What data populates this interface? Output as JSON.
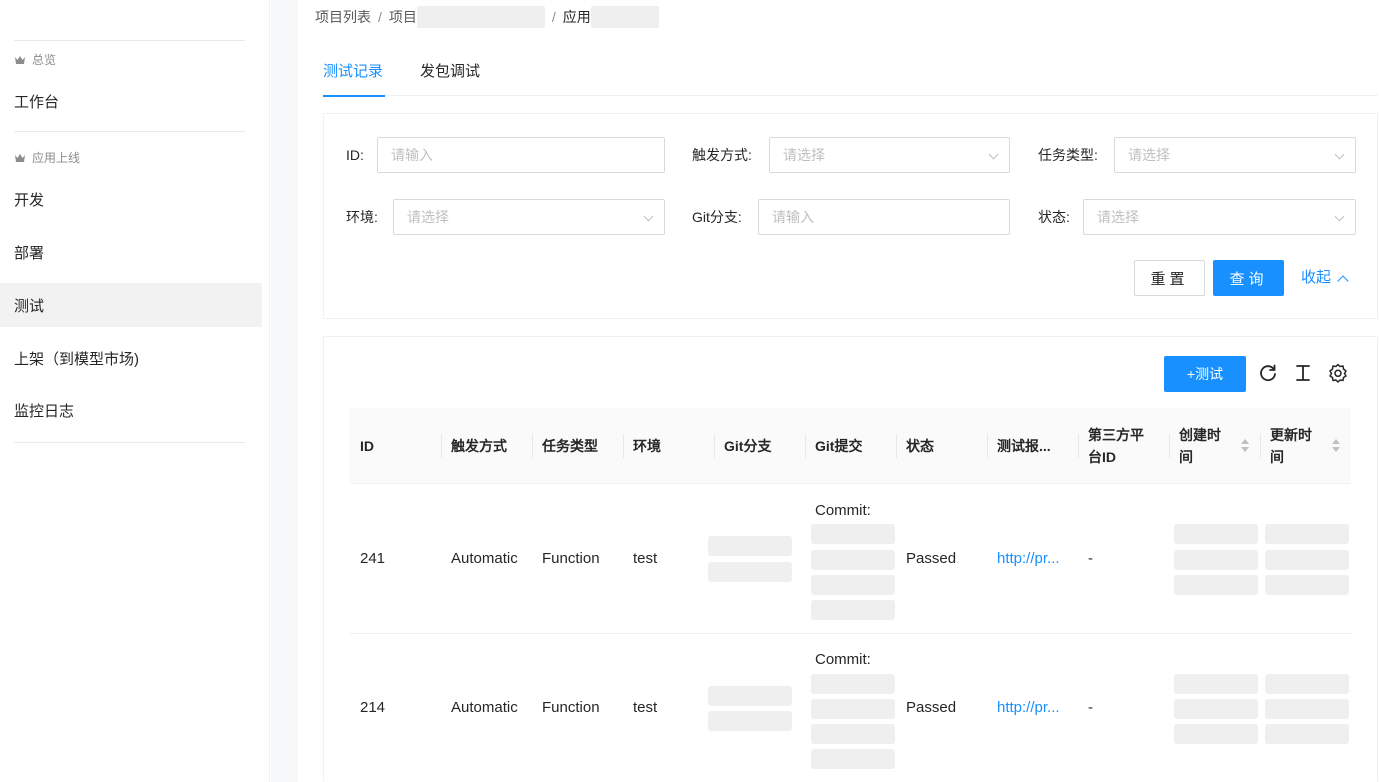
{
  "sidebar": {
    "group_overview": "总览",
    "item_workbench": "工作台",
    "group_launch": "应用上线",
    "item_develop": "开发",
    "item_deploy": "部署",
    "item_test": "测试",
    "item_publish": "上架（到模型市场)",
    "item_monitor": "监控日志"
  },
  "breadcrumb": {
    "project_list": "项目列表",
    "project": "项目",
    "app": "应用",
    "separator": "/"
  },
  "tabs": {
    "records": "测试记录",
    "debug": "发包调试"
  },
  "filters": {
    "id_label": "ID:",
    "id_placeholder": "请输入",
    "trigger_label": "触发方式:",
    "trigger_placeholder": "请选择",
    "task_type_label": "任务类型:",
    "task_type_placeholder": "请选择",
    "env_label": "环境:",
    "env_placeholder": "请选择",
    "branch_label": "Git分支:",
    "branch_placeholder": "请输入",
    "status_label": "状态:",
    "status_placeholder": "请选择",
    "reset_button": "重置",
    "query_button": "查询",
    "collapse_link": "收起"
  },
  "table": {
    "add_button": "+测试",
    "columns": {
      "id": "ID",
      "trigger": "触发方式",
      "task_type": "任务类型",
      "env": "环境",
      "branch": "Git分支",
      "commit": "Git提交",
      "status": "状态",
      "report": "测试报...",
      "third_party_line1": "第三方平",
      "third_party_line2": "台ID",
      "created_line1": "创建时",
      "created_line2": "间",
      "updated_line1": "更新时",
      "updated_line2": "间"
    },
    "rows": [
      {
        "id": "241",
        "trigger": "Automatic",
        "task_type": "Function",
        "env": "test",
        "commit_prefix": "Commit:",
        "status": "Passed",
        "report": "http://pr...",
        "third_party": "-"
      },
      {
        "id": "214",
        "trigger": "Automatic",
        "task_type": "Function",
        "env": "test",
        "commit_prefix": "Commit:",
        "status": "Passed",
        "report": "http://pr...",
        "third_party": "-"
      }
    ]
  },
  "colors": {
    "primary": "#1890ff",
    "active_nav_bg": "#f2f2f2",
    "redaction": "#efefef"
  },
  "icons": [
    "crown-icon",
    "reload-icon",
    "column-height-icon",
    "settings-icon",
    "chevron-down-icon",
    "chevron-up-icon",
    "sort-icon"
  ]
}
